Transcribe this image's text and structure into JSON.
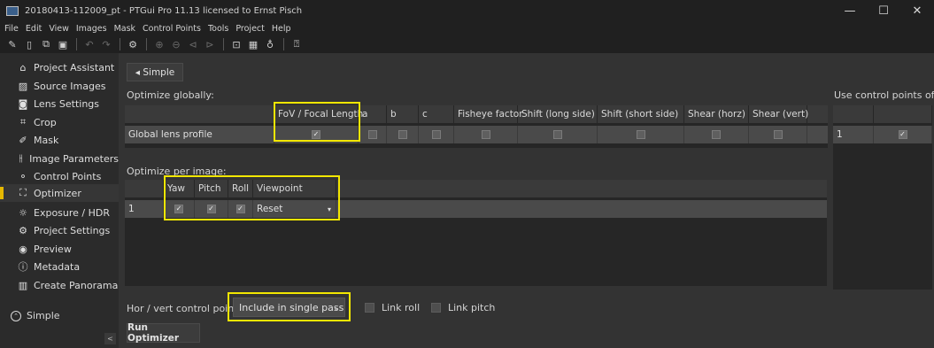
{
  "titlebar": {
    "title": "20180413-112009_pt - PTGui Pro 11.13 licensed to Ernst Pisch",
    "minimize": "—",
    "maximize": "☐",
    "close": "✕"
  },
  "menu": [
    "File",
    "Edit",
    "View",
    "Images",
    "Mask",
    "Control Points",
    "Tools",
    "Project",
    "Help"
  ],
  "toolbar": {
    "new_icon": "new-project-icon",
    "open_icon": "open-icon",
    "duplicate_icon": "duplicate-icon",
    "save_icon": "save-icon",
    "undo_icon": "undo-icon",
    "redo_icon": "redo-icon",
    "settings_icon": "settings-icon",
    "zoom_in_icon": "zoom-in-icon",
    "zoom_out_icon": "zoom-out-icon",
    "prev_icon": "prev-icon",
    "next_icon": "next-icon",
    "panorama_editor_icon": "panorama-editor-icon",
    "table_icon": "table-icon",
    "lightbulb_icon": "lightbulb-icon",
    "help_icon": "help-icon"
  },
  "sidebar": {
    "items": [
      {
        "label": "Project Assistant",
        "icon": "home-icon",
        "glyph": "⌂"
      },
      {
        "label": "Source Images",
        "icon": "image-icon",
        "glyph": "▨"
      },
      {
        "label": "Lens Settings",
        "icon": "camera-icon",
        "glyph": "◙"
      },
      {
        "label": "Crop",
        "icon": "crop-icon",
        "glyph": "⌗"
      },
      {
        "label": "Mask",
        "icon": "brush-icon",
        "glyph": "✐"
      },
      {
        "label": "Image Parameters",
        "icon": "sliders-icon",
        "glyph": "⫲"
      },
      {
        "label": "Control Points",
        "icon": "control-points-icon",
        "glyph": "⚬"
      },
      {
        "label": "Optimizer",
        "icon": "optimizer-icon",
        "glyph": "⛶"
      },
      {
        "label": "Exposure / HDR",
        "icon": "sun-icon",
        "glyph": "☼"
      },
      {
        "label": "Project Settings",
        "icon": "gear-icon",
        "glyph": "⚙"
      },
      {
        "label": "Preview",
        "icon": "eye-icon",
        "glyph": "◉"
      },
      {
        "label": "Metadata",
        "icon": "info-icon",
        "glyph": "ⓘ"
      },
      {
        "label": "Create Panorama",
        "icon": "panorama-icon",
        "glyph": "▥"
      }
    ],
    "active_index": 7,
    "simple_label": "Simple",
    "collapse_glyph": "<"
  },
  "main": {
    "simple_button": "◂ Simple",
    "optimize_globally": "Optimize globally:",
    "global_table": {
      "headers": [
        "",
        "FoV / Focal Length",
        "a",
        "b",
        "c",
        "Fisheye factor",
        "Shift (long side)",
        "Shift (short side)",
        "Shear (horz)",
        "Shear (vert)"
      ],
      "row_label": "Global lens profile",
      "checked": [
        true,
        false,
        false,
        false,
        false,
        false,
        false,
        false,
        false
      ]
    },
    "use_control_points": "Use control points of:",
    "cp_table": {
      "row_label": "1",
      "checked": true
    },
    "optimize_per_image": "Optimize per image:",
    "per_image_table": {
      "headers": [
        "",
        "Yaw",
        "Pitch",
        "Roll",
        "Viewpoint"
      ],
      "row_label": "1",
      "checked": [
        true,
        true,
        true
      ],
      "viewpoint_value": "Reset"
    },
    "hor_vert_label": "Hor / vert control points:",
    "hor_vert_value": "Include in single pass",
    "link_roll": "Link roll",
    "link_pitch": "Link pitch",
    "run_button": "Run Optimizer"
  },
  "colors": {
    "highlight": "#f2e600",
    "active_bar": "#e6b800"
  }
}
